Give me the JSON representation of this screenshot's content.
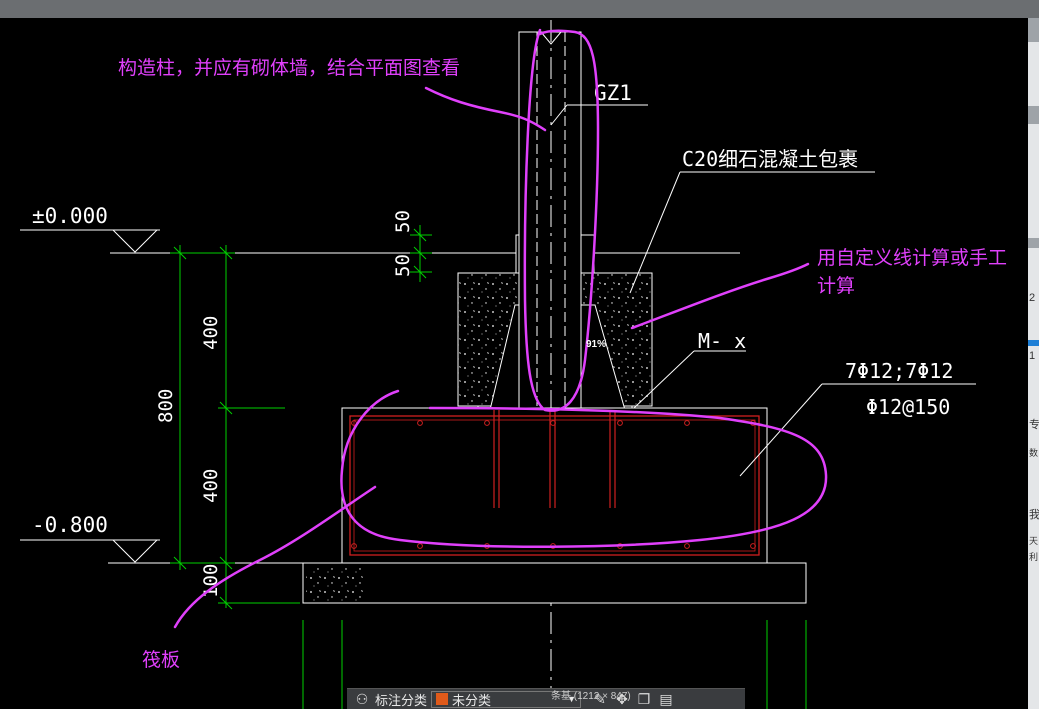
{
  "drawing": {
    "elevation_top": "±0.000",
    "elevation_bottom": "-0.800",
    "column_label": "GZ1",
    "concrete_note": "C20细石混凝土包裹",
    "section_mark": "M- x",
    "rebar_top": "7Φ12;7Φ12",
    "rebar_bottom": "Φ12@150",
    "dims": {
      "d50a": "50",
      "d50b": "50",
      "d400a": "400",
      "d400b": "400",
      "d800": "800",
      "d100": "100"
    }
  },
  "annotations": {
    "column_note": "构造柱，并应有砌体墙，结合平面图查看",
    "calc_note_line1": "用自定义线计算或手工",
    "calc_note_line2": "计算",
    "raft_note": "筏板"
  },
  "zoom_badge": "91%",
  "image_caption": "条基 (1212 × 847)",
  "toolbar": {
    "label": "标注分类",
    "category": "未分类"
  },
  "right_panel": {
    "t1": "2",
    "t2": "1",
    "t3": "专",
    "t4": "数",
    "t5": "我",
    "t6": "天",
    "t7": "利"
  },
  "colors": {
    "annotation": "#e040fb",
    "dimension": "#00d000",
    "rebar": "#d02020",
    "outline": "#ffffff"
  }
}
